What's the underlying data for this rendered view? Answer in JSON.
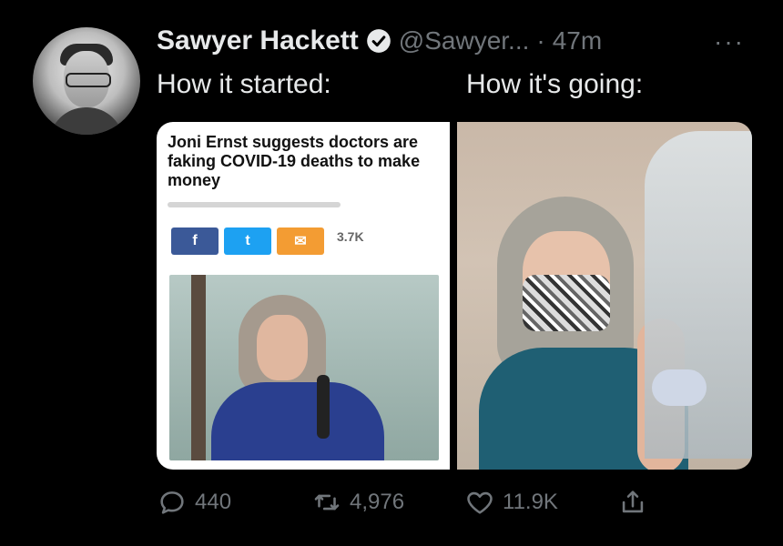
{
  "tweet": {
    "author": {
      "name": "Sawyer Hackett",
      "handle": "@Sawyer...",
      "verified_icon": "verified-badge-icon"
    },
    "separator": "·",
    "time": "47m",
    "more": "···",
    "caption_left": "How it started:",
    "caption_right": "How it's going:",
    "media": {
      "left": {
        "headline": "Joni Ernst suggests doctors are faking COVID-19 deaths to make money",
        "share_buttons": [
          {
            "label": "f",
            "icon": "facebook-icon"
          },
          {
            "label": "t",
            "icon": "twitter-icon"
          },
          {
            "label": "✉",
            "icon": "email-icon"
          }
        ],
        "share_count": "3.7K"
      }
    },
    "actions": {
      "reply_count": "440",
      "retweet_count": "4,976",
      "like_count": "11.9K",
      "colors": {
        "muted": "#71767b",
        "text": "#e7e9ea",
        "background": "#000000"
      }
    }
  }
}
